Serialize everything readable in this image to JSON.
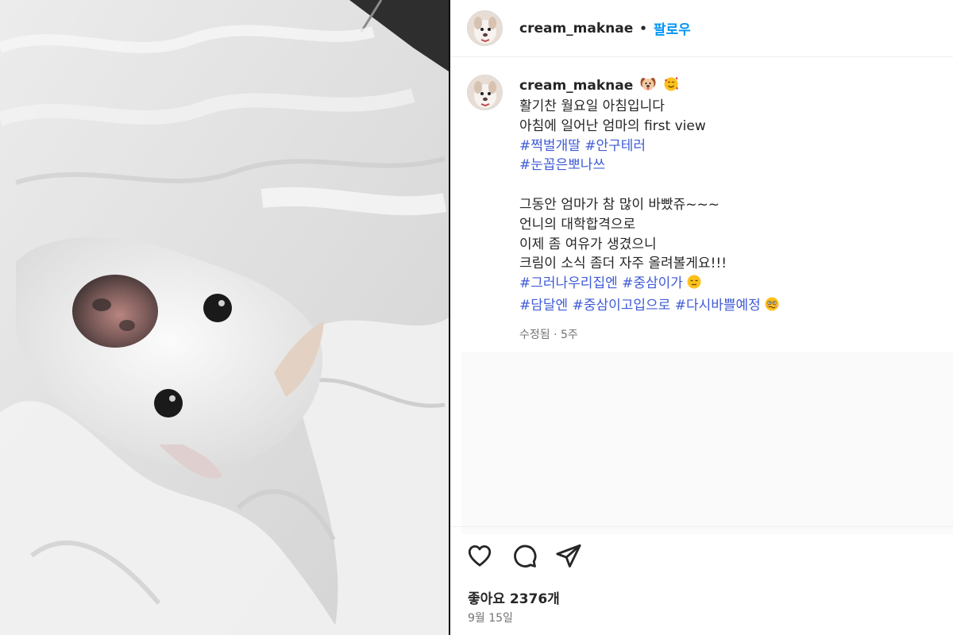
{
  "post": {
    "username": "cream_maknae",
    "follow_label": "팔로우",
    "header_separator": "•",
    "caption_lines": [
      {
        "text": "활기찬 월요일 아침입니다"
      },
      {
        "text": "아침에 일어난 엄마의 first view"
      },
      {
        "tags": [
          "#쩍벌개딸",
          "#안구테러"
        ]
      },
      {
        "tags": [
          "#눈꼽은뽀나쓰"
        ]
      },
      {
        "text": ""
      },
      {
        "text": "그동안 엄마가 참 많이 바빴쥬~~~"
      },
      {
        "text": "언니의 대학합격으로"
      },
      {
        "text": "이제 좀 여유가 생겼으니"
      },
      {
        "text": "크림이 소식 좀더 자주 올려볼게요!!!"
      },
      {
        "tags": [
          "#그러나우리집엔",
          "#중삼이가"
        ],
        "emoji": "expressionless-face-icon"
      },
      {
        "tags": [
          "#담달엔",
          "#중삼이고입으로",
          "#다시바쁠예정"
        ],
        "emoji": "woozy-face-icon"
      }
    ],
    "username_emojis": [
      "dog-face-icon",
      "smiling-face-hearts-icon"
    ],
    "meta": "수정됨 · 5주",
    "likes_text": "좋아요 2376개",
    "date_text": "9월 15일",
    "action_icons": [
      "heart-icon",
      "comment-icon",
      "share-icon"
    ]
  },
  "colors": {
    "hashtag": "#3f5bd6",
    "follow": "#0095f6",
    "secondary_text": "#737373"
  }
}
